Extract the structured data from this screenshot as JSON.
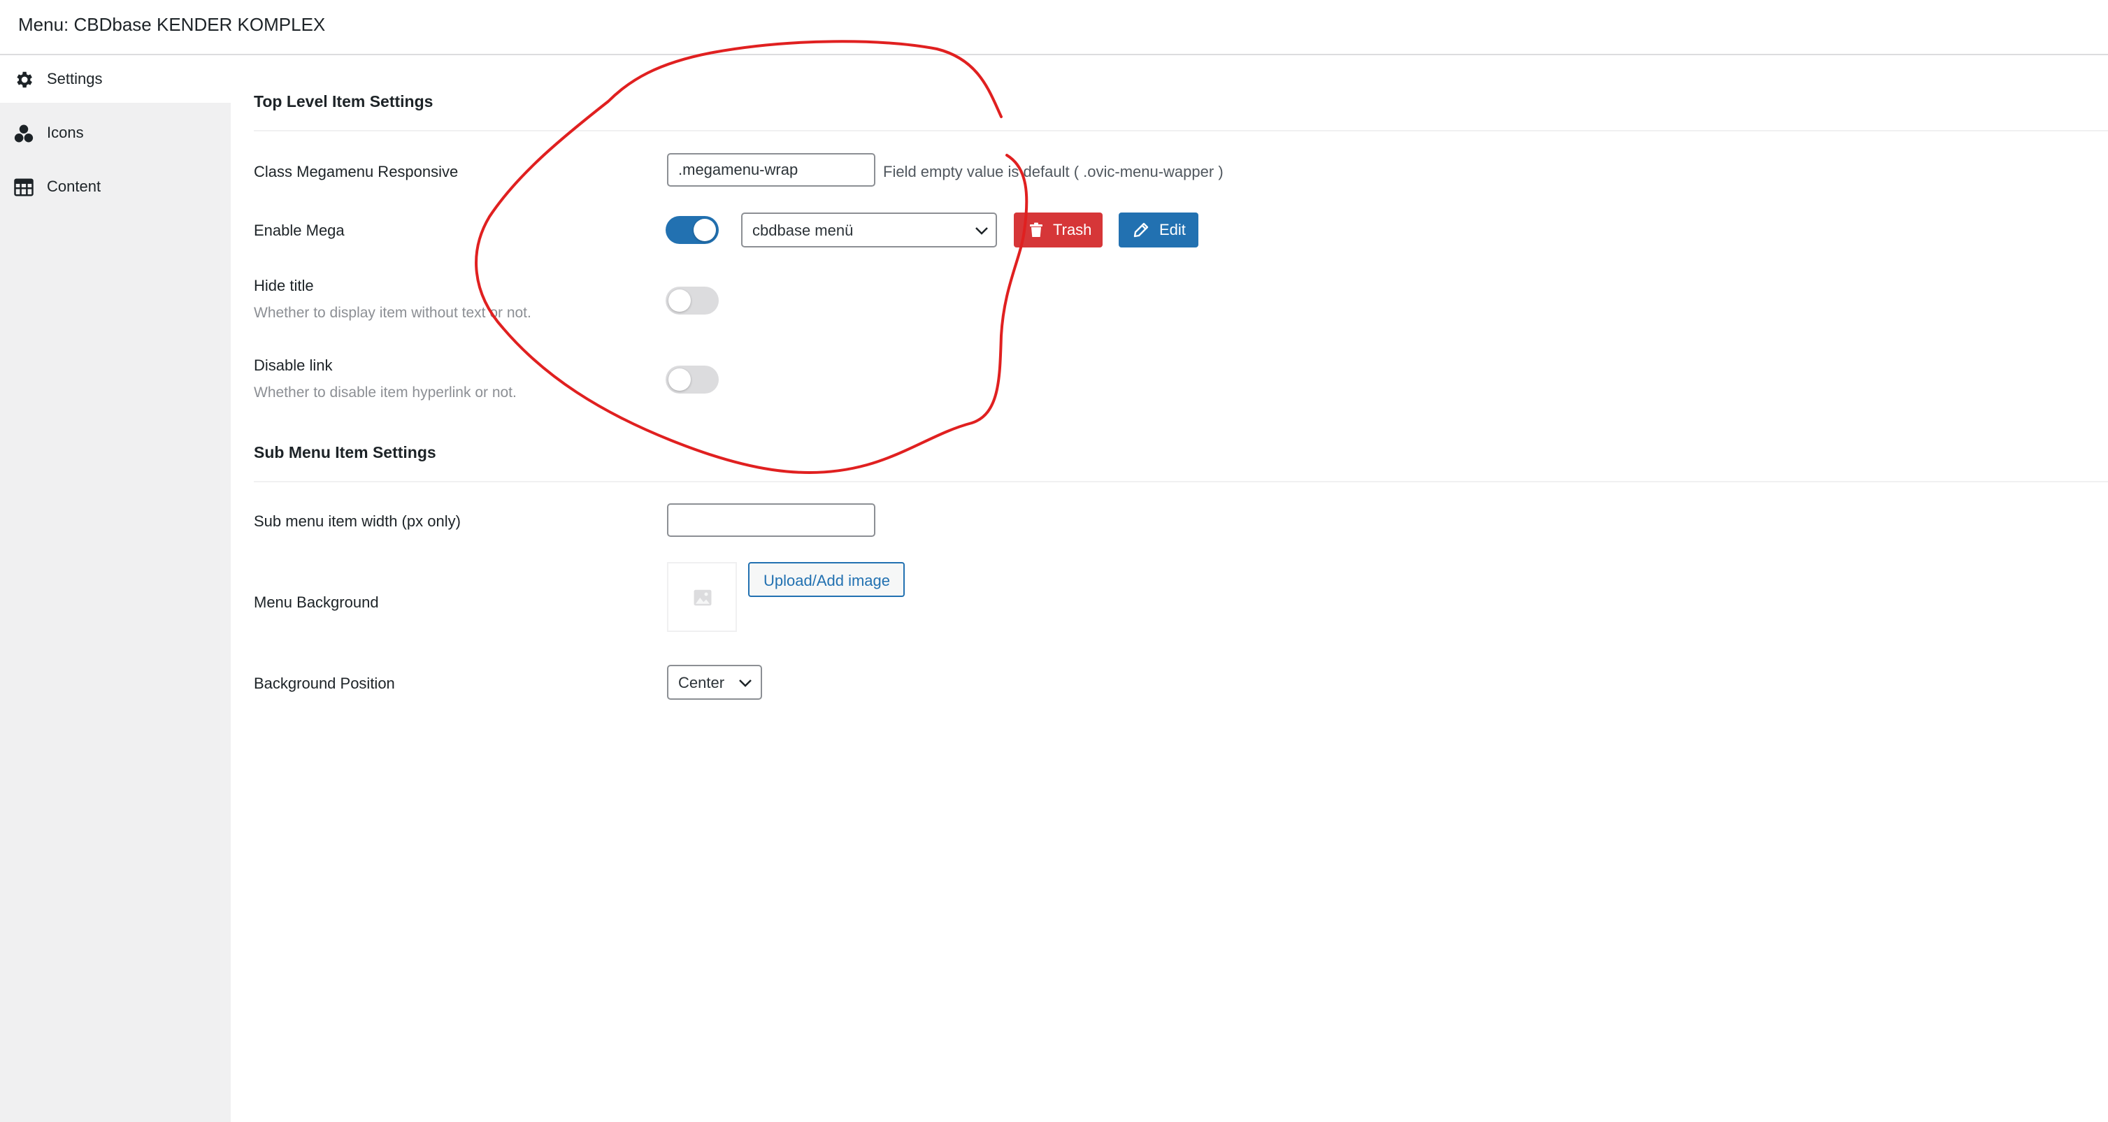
{
  "header": {
    "title": "Menu: CBDbase KENDER KOMPLEX"
  },
  "sidebar": {
    "items": [
      {
        "label": "Settings",
        "icon": "gear-icon",
        "active": true
      },
      {
        "label": "Icons",
        "icon": "circles-icon",
        "active": false
      },
      {
        "label": "Content",
        "icon": "table-icon",
        "active": false
      }
    ]
  },
  "top_level": {
    "title": "Top Level Item Settings",
    "class_megamenu": {
      "label": "Class Megamenu Responsive",
      "value": ".megamenu-wrap",
      "hint": "Field empty value is default ( .ovic-menu-wapper )"
    },
    "enable_mega": {
      "label": "Enable Mega",
      "enabled": true,
      "selected_menu": "cbdbase menü",
      "trash_label": "Trash",
      "edit_label": "Edit"
    },
    "hide_title": {
      "label": "Hide title",
      "description": "Whether to display item without text or not.",
      "enabled": false
    },
    "disable_link": {
      "label": "Disable link",
      "description": "Whether to disable item hyperlink or not.",
      "enabled": false
    }
  },
  "sub_menu": {
    "title": "Sub Menu Item Settings",
    "width": {
      "label": "Sub menu item width (px only)",
      "value": ""
    },
    "background": {
      "label": "Menu Background",
      "upload_label": "Upload/Add image"
    },
    "position": {
      "label": "Background Position",
      "value": "Center"
    }
  },
  "colors": {
    "primary": "#2271b1",
    "danger": "#d63638",
    "annotation": "#e02020"
  }
}
